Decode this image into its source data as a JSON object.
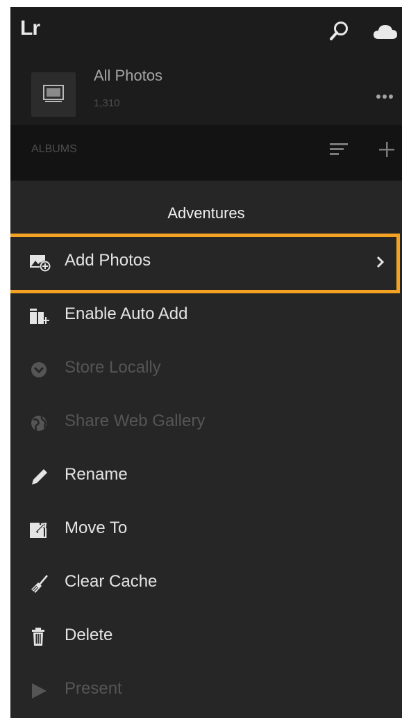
{
  "header": {
    "logo": "Lr"
  },
  "library": {
    "title": "All Photos",
    "count": "1,310"
  },
  "albums": {
    "label": "ALBUMS"
  },
  "menu": {
    "title": "Adventures",
    "items": [
      {
        "label": "Add Photos",
        "enabled": true,
        "icon": "add-photos-icon"
      },
      {
        "label": "Enable Auto Add",
        "enabled": true,
        "icon": "auto-add-icon"
      },
      {
        "label": "Store Locally",
        "enabled": false,
        "icon": "chevron-circle-icon"
      },
      {
        "label": "Share Web Gallery",
        "enabled": false,
        "icon": "globe-icon"
      },
      {
        "label": "Rename",
        "enabled": true,
        "icon": "pencil-icon"
      },
      {
        "label": "Move To",
        "enabled": true,
        "icon": "move-icon"
      },
      {
        "label": "Clear Cache",
        "enabled": true,
        "icon": "broom-icon"
      },
      {
        "label": "Delete",
        "enabled": true,
        "icon": "trash-icon"
      },
      {
        "label": "Present",
        "enabled": false,
        "icon": "play-icon"
      }
    ]
  },
  "colors": {
    "highlight": "#f4a223",
    "sheet": "#262626",
    "text": "#e4e4e4",
    "disabled": "#555555"
  }
}
